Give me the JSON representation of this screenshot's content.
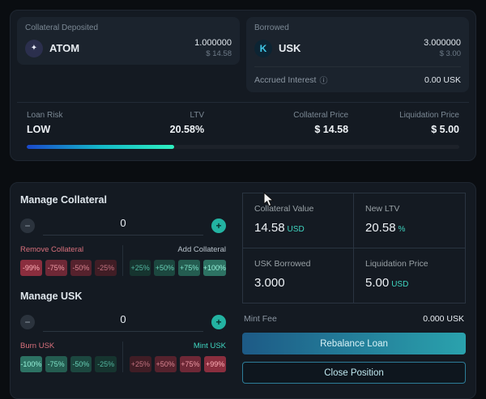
{
  "colors": {
    "accent_teal": "#3fd6c1",
    "risk_bar_gradient": [
      "#1a49cc",
      "#14b8c8",
      "#2ef0c0"
    ],
    "danger_text": "#d9707c"
  },
  "icons": {
    "atom": "✦",
    "usk": "K",
    "info": "ⓘ",
    "minus": "−",
    "plus": "+"
  },
  "overview": {
    "collateral": {
      "label": "Collateral Deposited",
      "asset": "ATOM",
      "amount": "1.000000",
      "usd": "$ 14.58"
    },
    "borrowed": {
      "label": "Borrowed",
      "asset": "USK",
      "amount": "3.000000",
      "usd": "$ 3.00"
    },
    "accrued": {
      "label": "Accrued Interest",
      "value": "0.00 USK"
    },
    "stats": [
      {
        "label": "Loan Risk",
        "value": "LOW"
      },
      {
        "label": "LTV",
        "value": "20.58%"
      },
      {
        "label": "Collateral Price",
        "value": "$ 14.58"
      },
      {
        "label": "Liquidation Price",
        "value": "$ 5.00"
      }
    ],
    "ltv_fill_width": "34%"
  },
  "manage_collateral": {
    "title": "Manage Collateral",
    "value": "0",
    "remove_label": "Remove Collateral",
    "add_label": "Add Collateral",
    "remove_buttons": [
      {
        "label": "-99%",
        "bg": "#8a2e3e",
        "fg": "#ffb0b8"
      },
      {
        "label": "-75%",
        "bg": "#6e2836",
        "fg": "#ef9aa5"
      },
      {
        "label": "-50%",
        "bg": "#55222d",
        "fg": "#d98591"
      },
      {
        "label": "-25%",
        "bg": "#401d25",
        "fg": "#c27380"
      }
    ],
    "add_buttons": [
      {
        "label": "+25%",
        "bg": "#16342f",
        "fg": "#53b7a0"
      },
      {
        "label": "+50%",
        "bg": "#1c473f",
        "fg": "#68cfb6"
      },
      {
        "label": "+75%",
        "bg": "#245c50",
        "fg": "#7fe3c9"
      },
      {
        "label": "+100%",
        "bg": "#2d7263",
        "fg": "#97f2da"
      }
    ]
  },
  "manage_usk": {
    "title": "Manage USK",
    "value": "0",
    "burn_label": "Burn USK",
    "mint_label": "Mint USK",
    "burn_buttons": [
      {
        "label": "-100%",
        "bg": "#2d7263",
        "fg": "#97f2da"
      },
      {
        "label": "-75%",
        "bg": "#245c50",
        "fg": "#7fe3c9"
      },
      {
        "label": "-50%",
        "bg": "#1c473f",
        "fg": "#68cfb6"
      },
      {
        "label": "-25%",
        "bg": "#16342f",
        "fg": "#53b7a0"
      }
    ],
    "mint_buttons": [
      {
        "label": "+25%",
        "bg": "#401d25",
        "fg": "#c27380"
      },
      {
        "label": "+50%",
        "bg": "#55222d",
        "fg": "#d98591"
      },
      {
        "label": "+75%",
        "bg": "#6e2836",
        "fg": "#ef9aa5"
      },
      {
        "label": "+99%",
        "bg": "#8a2e3e",
        "fg": "#ffb0b8"
      }
    ]
  },
  "summary": {
    "cells": [
      {
        "label": "Collateral Value",
        "value": "14.58",
        "unit": "USD"
      },
      {
        "label": "New LTV",
        "value": "20.58",
        "unit": "%"
      },
      {
        "label": "USK Borrowed",
        "value": "3.000",
        "unit": ""
      },
      {
        "label": "Liquidation Price",
        "value": "5.00",
        "unit": "USD"
      }
    ],
    "mint_fee_label": "Mint Fee",
    "mint_fee_value": "0.000 USK",
    "rebalance_button": "Rebalance Loan",
    "close_button": "Close Position"
  }
}
